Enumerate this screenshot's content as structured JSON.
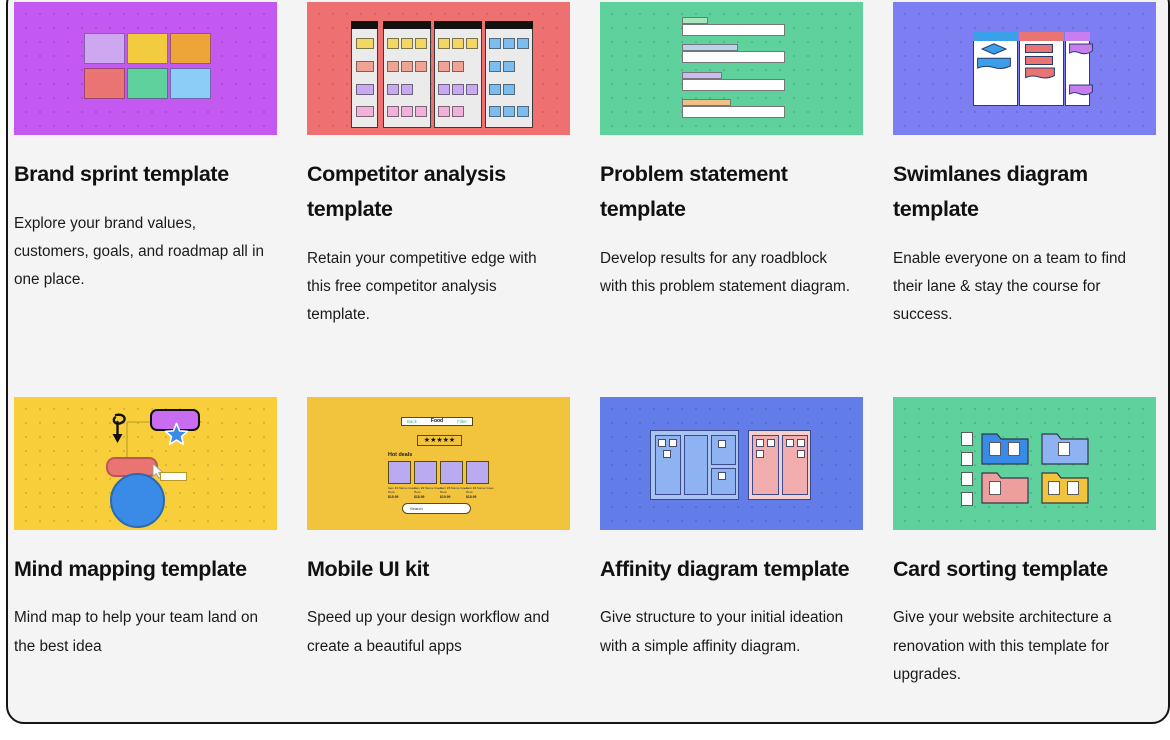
{
  "page": {
    "background": "#f4f4f4",
    "border_color": "#141414"
  },
  "cards": [
    {
      "title": "Brand sprint template",
      "description": "Explore your brand values, customers, goals, and roadmap all in one place.",
      "thumb": {
        "name": "brand-sprint-thumbnail",
        "bg": "#c359f0"
      }
    },
    {
      "title": "Competitor analysis template",
      "description": "Retain your competitive edge with this free competitor analysis template.",
      "thumb": {
        "name": "competitor-analysis-thumbnail",
        "bg": "#ee7070"
      }
    },
    {
      "title": "Problem statement template",
      "description": "Develop results for any roadblock with this problem statement diagram.",
      "thumb": {
        "name": "problem-statement-thumbnail",
        "bg": "#5fd19c"
      }
    },
    {
      "title": "Swimlanes diagram template",
      "description": "Enable everyone on a team to find their lane & stay the course for success.",
      "thumb": {
        "name": "swimlanes-diagram-thumbnail",
        "bg": "#7c7ef2"
      }
    },
    {
      "title": "Mind mapping template",
      "description": "Mind map to help your team land on the best idea",
      "thumb": {
        "name": "mind-mapping-thumbnail",
        "bg": "#f8cf3b"
      }
    },
    {
      "title": "Mobile UI kit",
      "description": "Speed up your design workflow and create a beautiful apps",
      "thumb": {
        "name": "mobile-ui-kit-thumbnail",
        "bg": "#f2c33c"
      }
    },
    {
      "title": "Affinity diagram template",
      "description": "Give structure to your initial ideation with a simple affinity diagram.",
      "thumb": {
        "name": "affinity-diagram-thumbnail",
        "bg": "#627de8"
      }
    },
    {
      "title": "Card sorting template",
      "description": "Give your website architecture a renovation with this template for upgrades.",
      "thumb": {
        "name": "card-sorting-thumbnail",
        "bg": "#5fd19c"
      }
    }
  ],
  "mobile_ui_kit_preview": {
    "nav_back": "Back",
    "nav_title": "Food",
    "nav_filter": "Filter",
    "stars": "★★★★★",
    "section_label": "Hot deals",
    "items": [
      {
        "name": "Item #1 Name Goes Here",
        "price": "$19.99"
      },
      {
        "name": "Item #2 Name Goes Here",
        "price": "$18.99"
      },
      {
        "name": "Item #3 Name Goes Here",
        "price": "$19.99"
      },
      {
        "name": "Item #4 Name Goes Here",
        "price": "$18.99"
      }
    ],
    "search_placeholder": "Search"
  },
  "palette": {
    "brand_squares": [
      "#cda8f0",
      "#f2cb3f",
      "#eda53a",
      "#ea7471",
      "#5fd19c",
      "#8ccdf5"
    ],
    "competitor_cards": [
      "#f2d765",
      "#f0a394",
      "#c9aaf2",
      "#f2b0dc",
      "#7cbdf0"
    ],
    "problem_tabs": [
      "#a8e6bc",
      "#b6d4f2",
      "#cdbaf5",
      "#f0c187"
    ],
    "swimlane_headers": [
      "#3aa0e8",
      "#ea7471",
      "#c87ef0"
    ],
    "affinity_groups": [
      "#8fb3f2",
      "#f2aeae"
    ],
    "card_sorting_folders": [
      "#3a8ae8",
      "#8fb3f2",
      "#ef9e9e",
      "#f2c33c"
    ]
  }
}
